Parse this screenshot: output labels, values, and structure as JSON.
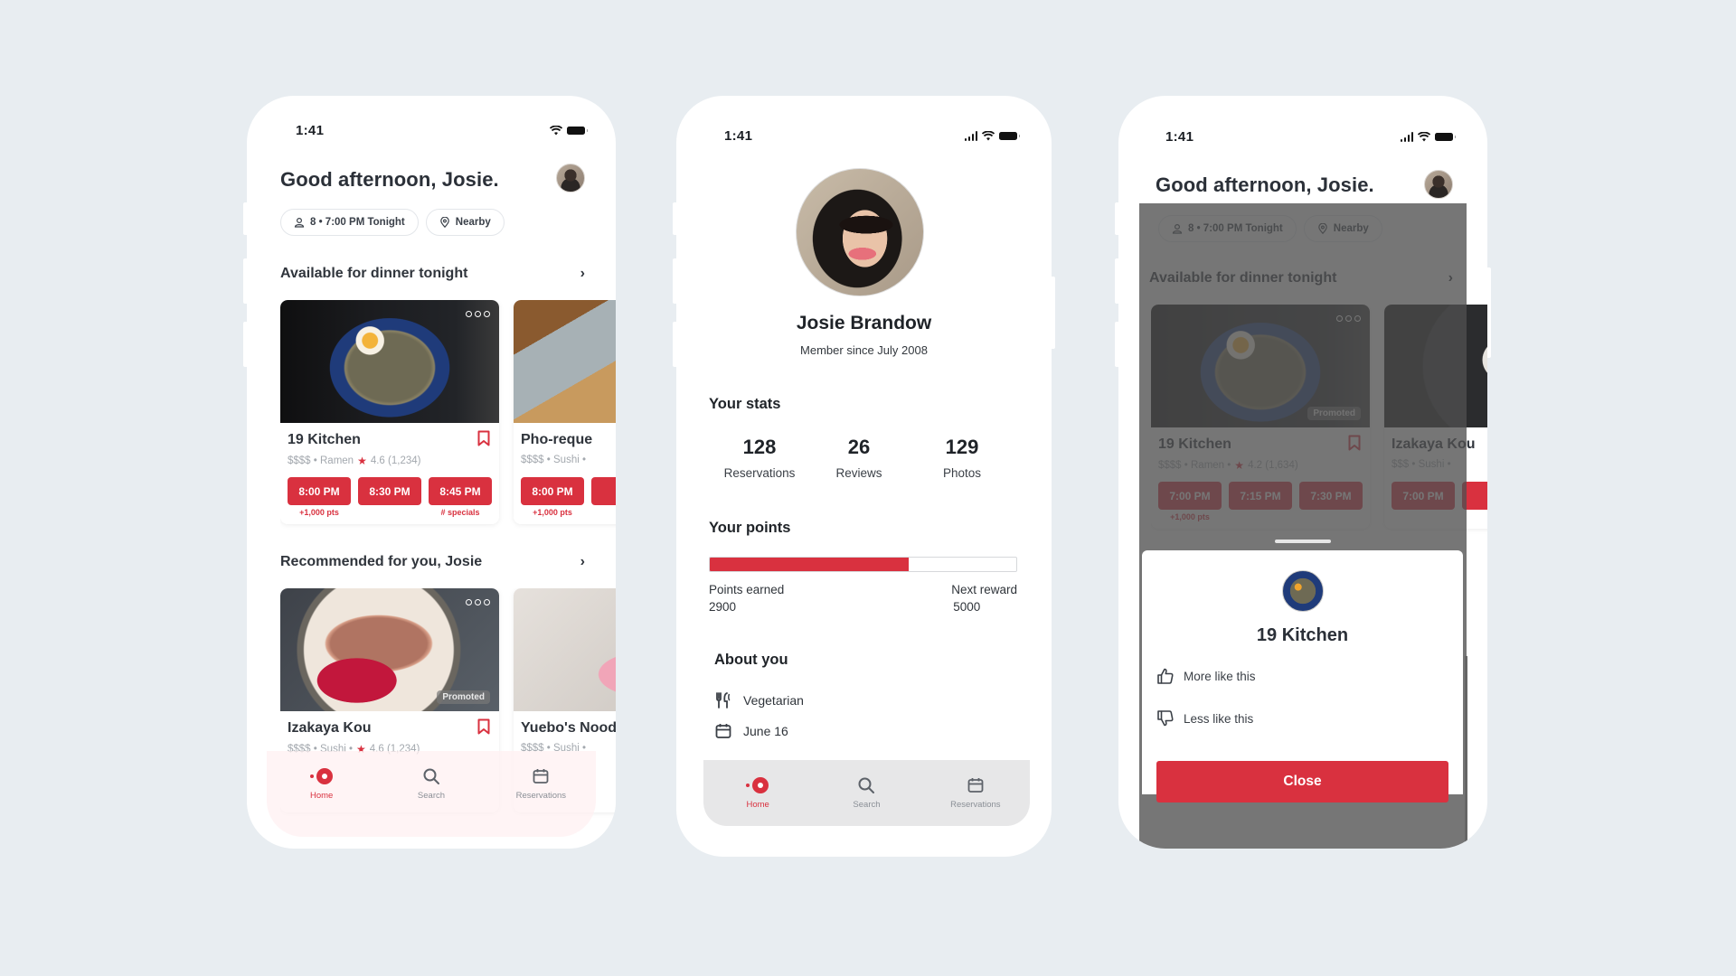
{
  "colors": {
    "background": "#e8edf1",
    "accent": "#d9313f",
    "text_primary": "#2b3038",
    "text_muted": "#a3a8ae"
  },
  "status_bar": {
    "time": "1:41"
  },
  "home": {
    "greeting": "Good afternoon, Josie.",
    "chips": [
      {
        "icon": "person-icon",
        "label": "8 • 7:00 PM Tonight"
      },
      {
        "icon": "location-pin-icon",
        "label": "Nearby"
      }
    ],
    "sections": [
      {
        "title": "Available for dinner tonight",
        "cards": [
          {
            "name": "19 Kitchen",
            "meta": "$$$$ • Ramen",
            "rating": "4.6 (1,234)",
            "times": [
              {
                "label": "8:00 PM",
                "sub": "+1,000 pts"
              },
              {
                "label": "8:30 PM",
                "sub": ""
              },
              {
                "label": "8:45 PM",
                "sub": "# specials"
              }
            ]
          },
          {
            "name": "Pho-reque",
            "meta": "$$$$ • Sushi •",
            "times": [
              {
                "label": "8:00 PM",
                "sub": "+1,000 pts"
              }
            ]
          }
        ]
      },
      {
        "title": "Recommended for you, Josie",
        "cards": [
          {
            "name": "Izakaya Kou",
            "meta": "$$$$ • Sushi •",
            "rating": "4.6 (1,234)",
            "badge": "Promoted"
          },
          {
            "name": "Yuebo's Noodles",
            "meta": "$$$$ • Sushi •"
          }
        ]
      }
    ]
  },
  "tabbar": {
    "tabs": [
      {
        "label": "Home",
        "icon": "home-icon",
        "active": true
      },
      {
        "label": "Search",
        "icon": "search-icon",
        "active": false
      },
      {
        "label": "Reservations",
        "icon": "calendar-icon",
        "active": false
      }
    ]
  },
  "profile": {
    "name": "Josie Brandow",
    "member_since": "Member since July 2008",
    "stats_title": "Your stats",
    "stats": [
      {
        "value": "128",
        "label": "Reservations"
      },
      {
        "value": "26",
        "label": "Reviews"
      },
      {
        "value": "129",
        "label": "Photos"
      }
    ],
    "points_title": "Your points",
    "points": {
      "earned_label": "Points earned",
      "earned": "2900",
      "next_label": "Next reward",
      "next": "5000",
      "progress_fraction": 0.65
    },
    "about_title": "About you",
    "about": [
      {
        "icon": "utensils-icon",
        "label": "Vegetarian"
      },
      {
        "icon": "calendar-icon",
        "label": "June 16"
      }
    ]
  },
  "home_dimmed": {
    "greeting": "Good afternoon, Josie.",
    "chips": [
      {
        "label": "8 • 7:00 PM Tonight"
      },
      {
        "label": "Nearby"
      }
    ],
    "section_title": "Available for dinner tonight",
    "cards": [
      {
        "name": "19 Kitchen",
        "meta": "$$$$ • Ramen •",
        "rating": "4.2 (1,634)",
        "badge": "Promoted",
        "times": [
          {
            "label": "7:00 PM",
            "sub": "+1,000 pts"
          },
          {
            "label": "7:15 PM",
            "sub": ""
          },
          {
            "label": "7:30 PM",
            "sub": ""
          }
        ]
      },
      {
        "name": "Izakaya Kou",
        "meta": "$$$ • Sushi •",
        "times": [
          {
            "label": "7:00 PM",
            "sub": ""
          }
        ]
      }
    ]
  },
  "sheet": {
    "restaurant_name": "19 Kitchen",
    "options": [
      {
        "icon": "thumbs-up-icon",
        "label": "More like this"
      },
      {
        "icon": "thumbs-down-icon",
        "label": "Less like this"
      }
    ],
    "close_label": "Close"
  }
}
